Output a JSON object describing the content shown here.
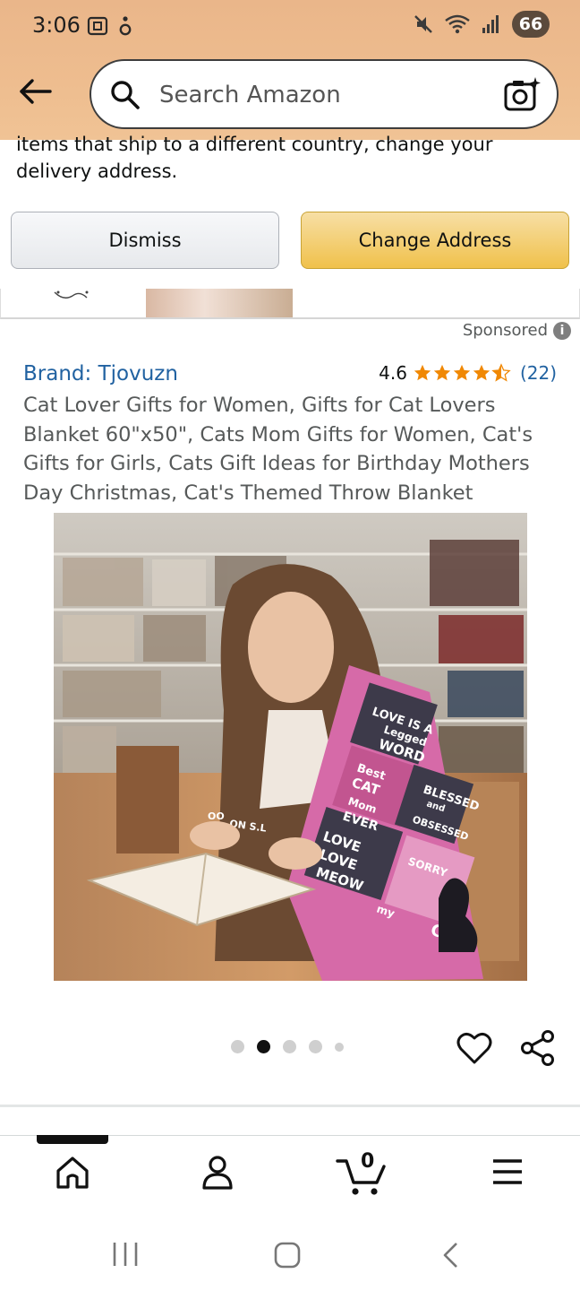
{
  "status_bar": {
    "time": "3:06",
    "battery": "66",
    "signal_label": "5"
  },
  "search": {
    "placeholder": "Search Amazon"
  },
  "banner": {
    "message": "items that ship to a different country, change your delivery address.",
    "dismiss_label": "Dismiss",
    "change_address_label": "Change Address"
  },
  "product": {
    "sponsored_label": "Sponsored",
    "brand": "Brand: Tjovuzn",
    "rating": "4.6",
    "stars": 4.5,
    "review_count": "(22)",
    "title": "Cat Lover Gifts for Women, Gifts for Cat Lovers Blanket 60\"x50\", Cats Mom Gifts for Women, Cat's Gifts for Girls, Cats Gift Ideas for Birthday Mothers Day Christmas, Cat's Themed Throw Blanket",
    "image_dots": {
      "count": 5,
      "active_index": 1
    },
    "blanket_texts": [
      "LOVE IS A",
      "Legged",
      "WORD",
      "Best",
      "CAT",
      "Mom",
      "EVER",
      "BLESSED",
      "and",
      "OBSESSED",
      "LOVE",
      "LOVE",
      "MEOW",
      "SORRY",
      "my",
      "CAT",
      "ON S.L",
      "OO"
    ]
  },
  "bottom_nav": {
    "cart_count": "0",
    "items": [
      "home-icon",
      "account-icon",
      "cart-icon",
      "menu-icon"
    ]
  },
  "colors": {
    "header": "#eebd8f",
    "link": "#2162a1",
    "star": "#f08804",
    "change_address": "#f0c14b"
  }
}
